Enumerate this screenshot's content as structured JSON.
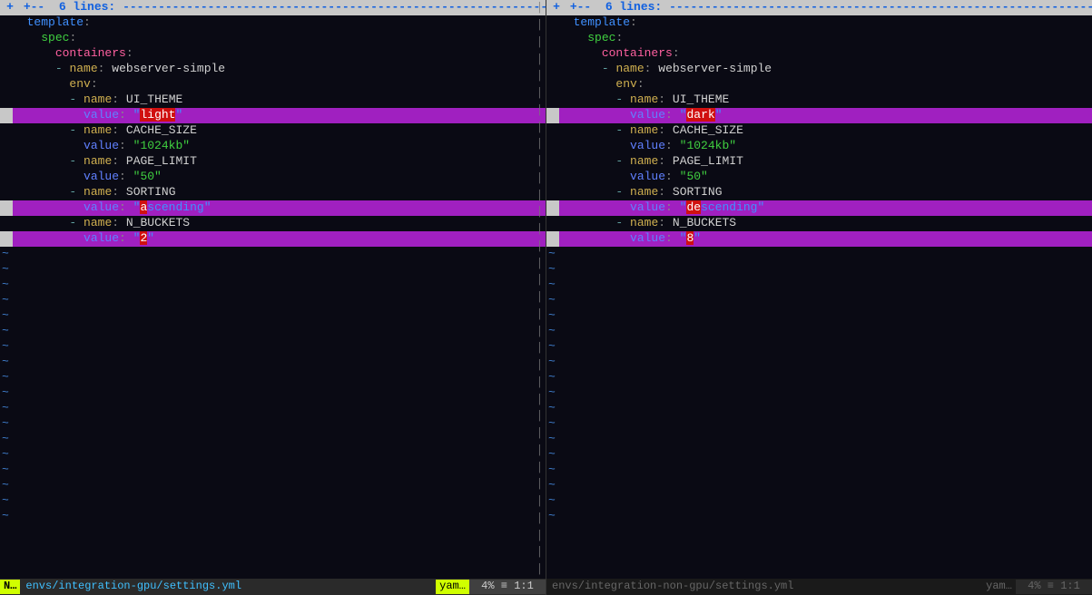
{
  "fold": {
    "marker": "+--",
    "count": "6 lines:",
    "dashes": "------------------------------------------------------------"
  },
  "left": {
    "lines": {
      "template": "template",
      "spec": "spec",
      "containers": "containers",
      "name0": "name",
      "name0v": "webserver-simple",
      "env": "env",
      "n1": "name",
      "n1v": "UI_THEME",
      "v1": "value",
      "v1q1": "\"",
      "v1diff": "light",
      "v1q2": "\"",
      "n2": "name",
      "n2v": "CACHE_SIZE",
      "v2": "value",
      "v2v": "\"1024kb\"",
      "n3": "name",
      "n3v": "PAGE_LIMIT",
      "v3": "value",
      "v3v": "\"50\"",
      "n4": "name",
      "n4v": "SORTING",
      "v4": "value",
      "v4q1": "\"",
      "v4pre": "a",
      "v4rest": "scending\"",
      "n5": "name",
      "n5v": "N_BUCKETS",
      "v5": "value",
      "v5q1": "\"",
      "v5diff": "2",
      "v5q2": "\""
    },
    "status": {
      "mode": "N…",
      "file": "envs/integration-gpu/settings.yml",
      "ft": "yam…",
      "pct": "4%",
      "sep": "≡",
      "pos": "1:1"
    }
  },
  "right": {
    "lines": {
      "template": "template",
      "spec": "spec",
      "containers": "containers",
      "name0": "name",
      "name0v": "webserver-simple",
      "env": "env",
      "n1": "name",
      "n1v": "UI_THEME",
      "v1": "value",
      "v1q1": "\"",
      "v1diff": "dark",
      "v1q2": "\"",
      "n2": "name",
      "n2v": "CACHE_SIZE",
      "v2": "value",
      "v2v": "\"1024kb\"",
      "n3": "name",
      "n3v": "PAGE_LIMIT",
      "v3": "value",
      "v3v": "\"50\"",
      "n4": "name",
      "n4v": "SORTING",
      "v4": "value",
      "v4q1": "\"",
      "v4pre": "de",
      "v4rest": "scending\"",
      "n5": "name",
      "n5v": "N_BUCKETS",
      "v5": "value",
      "v5q1": "\"",
      "v5diff": "8",
      "v5q2": "\""
    },
    "status": {
      "file": "envs/integration-non-gpu/settings.yml",
      "ft": "yam…",
      "pct": "4%",
      "sep": "≡",
      "pos": "1:1"
    }
  },
  "tilde": "~"
}
